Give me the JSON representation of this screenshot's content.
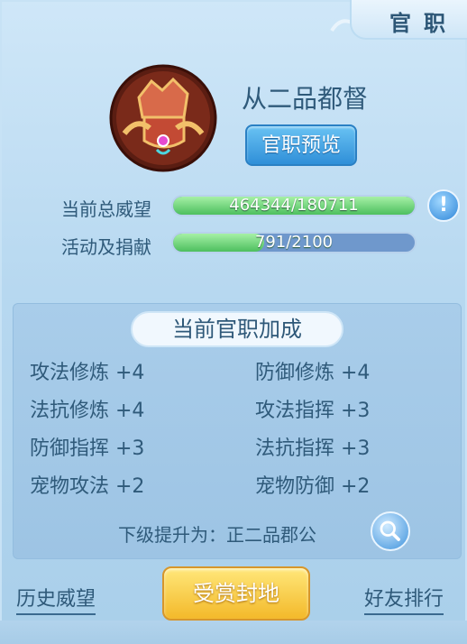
{
  "window": {
    "title": "官职"
  },
  "rank": {
    "name": "从二品都督",
    "preview_label": "官职预览"
  },
  "stats": [
    {
      "label": "当前总威望",
      "text": "464344/180711",
      "fill": 1.0
    },
    {
      "label": "活动及捐献",
      "text": "791/2100",
      "fill": 0.377
    }
  ],
  "bonus": {
    "title": "当前官职加成",
    "items": [
      {
        "text": "攻法修炼 +4"
      },
      {
        "text": "防御修炼 +4"
      },
      {
        "text": "法抗修炼 +4"
      },
      {
        "text": "攻法指挥 +3"
      },
      {
        "text": "防御指挥 +3"
      },
      {
        "text": "法抗指挥 +3"
      },
      {
        "text": "宠物攻法 +2"
      },
      {
        "text": "宠物防御 +2"
      }
    ],
    "next_rank": "下级提升为：正二品郡公"
  },
  "footer": {
    "history": "历史威望",
    "reward": "受赏封地",
    "ranking": "好友排行"
  },
  "colors": {
    "accent": "#2f8fd8",
    "gold": "#f3b92a",
    "progress_green": "#4dbf5e",
    "progress_track": "#6f98cc"
  },
  "icons": {
    "info": "exclamation-icon",
    "search": "magnifier-icon",
    "emblem": "helmet-icon"
  }
}
